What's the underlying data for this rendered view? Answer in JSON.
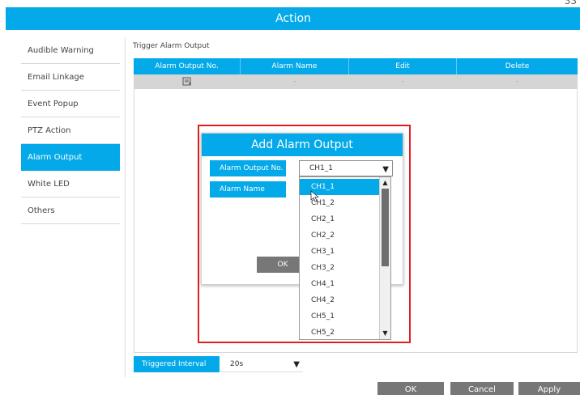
{
  "page_number": "33",
  "title": "Action",
  "sidebar": {
    "items": [
      {
        "label": "Audible Warning"
      },
      {
        "label": "Email Linkage"
      },
      {
        "label": "Event Popup"
      },
      {
        "label": "PTZ Action"
      },
      {
        "label": "Alarm Output"
      },
      {
        "label": "White LED"
      },
      {
        "label": "Others"
      }
    ],
    "active_item": "Alarm Output"
  },
  "section_title": "Trigger Alarm Output",
  "table": {
    "columns": [
      "Alarm Output No.",
      "Alarm Name",
      "Edit",
      "Delete"
    ],
    "rows": [
      {
        "alarm_output_no_icon": "add-icon",
        "alarm_name": "-",
        "edit": "-",
        "delete": "-"
      }
    ]
  },
  "dialog": {
    "title": "Add Alarm Output",
    "alarm_output_no_label": "Alarm Output No.",
    "alarm_output_no_value": "CH1_1",
    "alarm_name_label": "Alarm Name",
    "ok_label": "OK"
  },
  "dropdown": {
    "options": [
      "CH1_1",
      "CH1_2",
      "CH2_1",
      "CH2_2",
      "CH3_1",
      "CH3_2",
      "CH4_1",
      "CH4_2",
      "CH5_1",
      "CH5_2"
    ],
    "selected": "CH1_1"
  },
  "triggered_interval": {
    "label": "Triggered Interval",
    "value": "20s"
  },
  "footer": {
    "ok_label": "OK",
    "cancel_label": "Cancel",
    "apply_label": "Apply"
  },
  "colors": {
    "accent": "#03a9e8",
    "highlight_border": "#e02020",
    "button_gray": "#777777"
  }
}
